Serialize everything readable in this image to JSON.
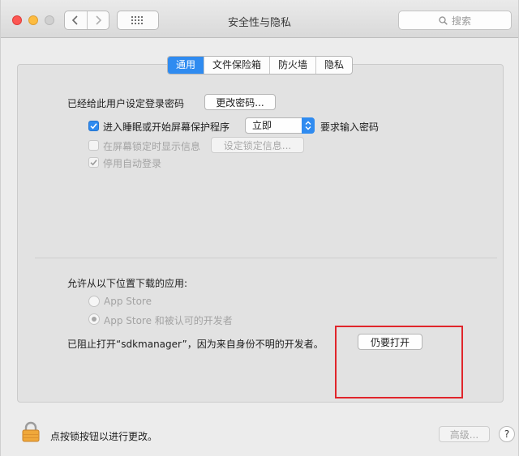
{
  "window": {
    "title": "安全性与隐私"
  },
  "toolbar": {
    "search_placeholder": "搜索"
  },
  "tabs": [
    {
      "label": "通用",
      "active": true
    },
    {
      "label": "文件保险箱",
      "active": false
    },
    {
      "label": "防火墙",
      "active": false
    },
    {
      "label": "隐私",
      "active": false
    }
  ],
  "general": {
    "password_label": "已经给此用户设定登录密码",
    "change_password_button": "更改密码...",
    "require_password": {
      "label_before": "进入睡眠或开始屏幕保护程序",
      "select_value": "立即",
      "label_after": "要求输入密码",
      "checked": true
    },
    "show_message": {
      "label": "在屏幕锁定时显示信息",
      "button": "设定锁定信息...",
      "checked": false
    },
    "disable_auto_login": {
      "label": "停用自动登录",
      "checked": true
    }
  },
  "downloads": {
    "heading": "允许从以下位置下载的应用:",
    "options": [
      {
        "label": "App Store",
        "selected": false
      },
      {
        "label": "App Store 和被认可的开发者",
        "selected": true
      }
    ],
    "blocked_message": "已阻止打开“sdkmanager”，因为来自身份不明的开发者。",
    "open_anyway_button": "仍要打开"
  },
  "footer": {
    "lock_message": "点按锁按钮以进行更改。",
    "advanced_button": "高级...",
    "help_label": "?"
  },
  "colors": {
    "accent": "#2f8bf0",
    "highlight_box": "#e0252b",
    "close": "#fc5753",
    "minimize": "#fdbc40"
  }
}
